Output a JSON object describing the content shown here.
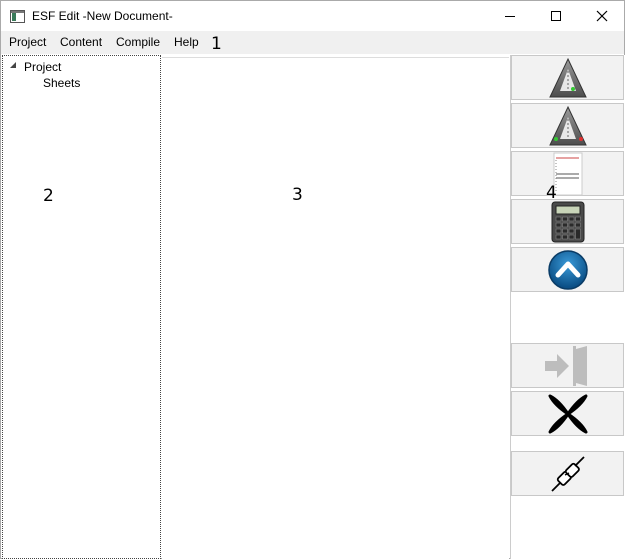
{
  "window": {
    "title": "ESF Edit -New Document-"
  },
  "menu": {
    "items": [
      "Project",
      "Content",
      "Compile",
      "Help"
    ]
  },
  "overlay_labels": {
    "one": "1",
    "two": "2",
    "three": "3",
    "four": "4"
  },
  "tree": {
    "root": "Project",
    "child": "Sheets"
  },
  "toolbar": {
    "icons": [
      "triangle-forward-icon",
      "triangle-edit-icon",
      "document-list-icon",
      "calculator-icon",
      "up-arrow-circle-icon",
      "exit-door-icon",
      "x-close-icon",
      "plug-connect-icon"
    ]
  }
}
